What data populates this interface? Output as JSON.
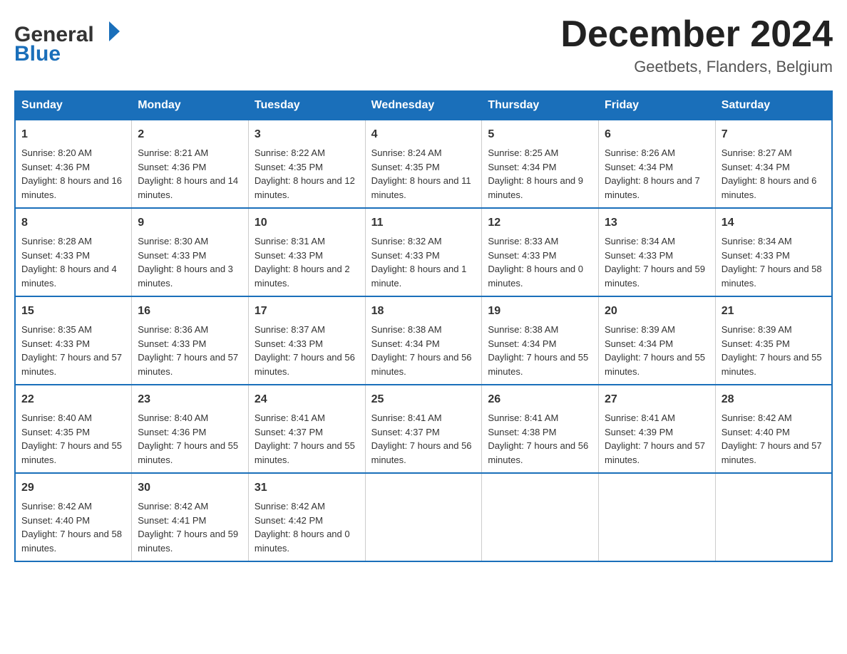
{
  "header": {
    "logo_general": "General",
    "logo_blue": "Blue",
    "month_title": "December 2024",
    "location": "Geetbets, Flanders, Belgium"
  },
  "days_of_week": [
    "Sunday",
    "Monday",
    "Tuesday",
    "Wednesday",
    "Thursday",
    "Friday",
    "Saturday"
  ],
  "weeks": [
    [
      {
        "day": "1",
        "sunrise": "Sunrise: 8:20 AM",
        "sunset": "Sunset: 4:36 PM",
        "daylight": "Daylight: 8 hours and 16 minutes."
      },
      {
        "day": "2",
        "sunrise": "Sunrise: 8:21 AM",
        "sunset": "Sunset: 4:36 PM",
        "daylight": "Daylight: 8 hours and 14 minutes."
      },
      {
        "day": "3",
        "sunrise": "Sunrise: 8:22 AM",
        "sunset": "Sunset: 4:35 PM",
        "daylight": "Daylight: 8 hours and 12 minutes."
      },
      {
        "day": "4",
        "sunrise": "Sunrise: 8:24 AM",
        "sunset": "Sunset: 4:35 PM",
        "daylight": "Daylight: 8 hours and 11 minutes."
      },
      {
        "day": "5",
        "sunrise": "Sunrise: 8:25 AM",
        "sunset": "Sunset: 4:34 PM",
        "daylight": "Daylight: 8 hours and 9 minutes."
      },
      {
        "day": "6",
        "sunrise": "Sunrise: 8:26 AM",
        "sunset": "Sunset: 4:34 PM",
        "daylight": "Daylight: 8 hours and 7 minutes."
      },
      {
        "day": "7",
        "sunrise": "Sunrise: 8:27 AM",
        "sunset": "Sunset: 4:34 PM",
        "daylight": "Daylight: 8 hours and 6 minutes."
      }
    ],
    [
      {
        "day": "8",
        "sunrise": "Sunrise: 8:28 AM",
        "sunset": "Sunset: 4:33 PM",
        "daylight": "Daylight: 8 hours and 4 minutes."
      },
      {
        "day": "9",
        "sunrise": "Sunrise: 8:30 AM",
        "sunset": "Sunset: 4:33 PM",
        "daylight": "Daylight: 8 hours and 3 minutes."
      },
      {
        "day": "10",
        "sunrise": "Sunrise: 8:31 AM",
        "sunset": "Sunset: 4:33 PM",
        "daylight": "Daylight: 8 hours and 2 minutes."
      },
      {
        "day": "11",
        "sunrise": "Sunrise: 8:32 AM",
        "sunset": "Sunset: 4:33 PM",
        "daylight": "Daylight: 8 hours and 1 minute."
      },
      {
        "day": "12",
        "sunrise": "Sunrise: 8:33 AM",
        "sunset": "Sunset: 4:33 PM",
        "daylight": "Daylight: 8 hours and 0 minutes."
      },
      {
        "day": "13",
        "sunrise": "Sunrise: 8:34 AM",
        "sunset": "Sunset: 4:33 PM",
        "daylight": "Daylight: 7 hours and 59 minutes."
      },
      {
        "day": "14",
        "sunrise": "Sunrise: 8:34 AM",
        "sunset": "Sunset: 4:33 PM",
        "daylight": "Daylight: 7 hours and 58 minutes."
      }
    ],
    [
      {
        "day": "15",
        "sunrise": "Sunrise: 8:35 AM",
        "sunset": "Sunset: 4:33 PM",
        "daylight": "Daylight: 7 hours and 57 minutes."
      },
      {
        "day": "16",
        "sunrise": "Sunrise: 8:36 AM",
        "sunset": "Sunset: 4:33 PM",
        "daylight": "Daylight: 7 hours and 57 minutes."
      },
      {
        "day": "17",
        "sunrise": "Sunrise: 8:37 AM",
        "sunset": "Sunset: 4:33 PM",
        "daylight": "Daylight: 7 hours and 56 minutes."
      },
      {
        "day": "18",
        "sunrise": "Sunrise: 8:38 AM",
        "sunset": "Sunset: 4:34 PM",
        "daylight": "Daylight: 7 hours and 56 minutes."
      },
      {
        "day": "19",
        "sunrise": "Sunrise: 8:38 AM",
        "sunset": "Sunset: 4:34 PM",
        "daylight": "Daylight: 7 hours and 55 minutes."
      },
      {
        "day": "20",
        "sunrise": "Sunrise: 8:39 AM",
        "sunset": "Sunset: 4:34 PM",
        "daylight": "Daylight: 7 hours and 55 minutes."
      },
      {
        "day": "21",
        "sunrise": "Sunrise: 8:39 AM",
        "sunset": "Sunset: 4:35 PM",
        "daylight": "Daylight: 7 hours and 55 minutes."
      }
    ],
    [
      {
        "day": "22",
        "sunrise": "Sunrise: 8:40 AM",
        "sunset": "Sunset: 4:35 PM",
        "daylight": "Daylight: 7 hours and 55 minutes."
      },
      {
        "day": "23",
        "sunrise": "Sunrise: 8:40 AM",
        "sunset": "Sunset: 4:36 PM",
        "daylight": "Daylight: 7 hours and 55 minutes."
      },
      {
        "day": "24",
        "sunrise": "Sunrise: 8:41 AM",
        "sunset": "Sunset: 4:37 PM",
        "daylight": "Daylight: 7 hours and 55 minutes."
      },
      {
        "day": "25",
        "sunrise": "Sunrise: 8:41 AM",
        "sunset": "Sunset: 4:37 PM",
        "daylight": "Daylight: 7 hours and 56 minutes."
      },
      {
        "day": "26",
        "sunrise": "Sunrise: 8:41 AM",
        "sunset": "Sunset: 4:38 PM",
        "daylight": "Daylight: 7 hours and 56 minutes."
      },
      {
        "day": "27",
        "sunrise": "Sunrise: 8:41 AM",
        "sunset": "Sunset: 4:39 PM",
        "daylight": "Daylight: 7 hours and 57 minutes."
      },
      {
        "day": "28",
        "sunrise": "Sunrise: 8:42 AM",
        "sunset": "Sunset: 4:40 PM",
        "daylight": "Daylight: 7 hours and 57 minutes."
      }
    ],
    [
      {
        "day": "29",
        "sunrise": "Sunrise: 8:42 AM",
        "sunset": "Sunset: 4:40 PM",
        "daylight": "Daylight: 7 hours and 58 minutes."
      },
      {
        "day": "30",
        "sunrise": "Sunrise: 8:42 AM",
        "sunset": "Sunset: 4:41 PM",
        "daylight": "Daylight: 7 hours and 59 minutes."
      },
      {
        "day": "31",
        "sunrise": "Sunrise: 8:42 AM",
        "sunset": "Sunset: 4:42 PM",
        "daylight": "Daylight: 8 hours and 0 minutes."
      },
      null,
      null,
      null,
      null
    ]
  ]
}
